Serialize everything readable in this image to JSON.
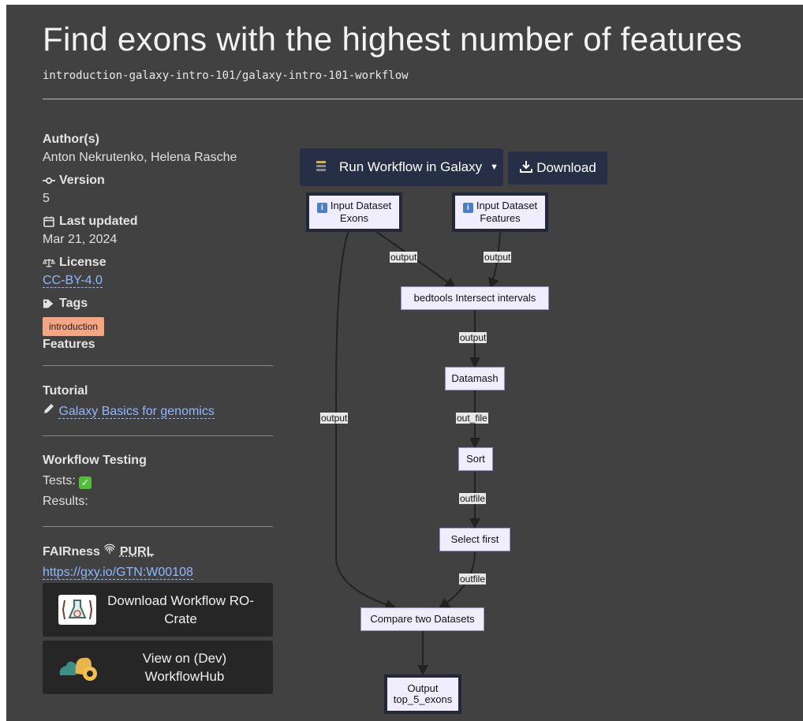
{
  "page": {
    "title": "Find exons with the highest number of features",
    "path": "introduction-galaxy-intro-101/galaxy-intro-101-workflow"
  },
  "meta": {
    "authors_label": "Author(s)",
    "authors": "Anton Nekrutenko, Helena Rasche",
    "version_label": "Version",
    "version": "5",
    "updated_label": "Last updated",
    "updated": "Mar 21, 2024",
    "license_label": "License",
    "license": "CC-BY-4.0",
    "tags_label": "Tags",
    "tags": [
      "introduction"
    ],
    "features_label": "Features"
  },
  "tutorial": {
    "label": "Tutorial",
    "link": "Galaxy Basics for genomics"
  },
  "testing": {
    "label": "Workflow Testing",
    "tests": "Tests:",
    "results": "Results:"
  },
  "fairness": {
    "label": "FAIRness",
    "purl": "PURL",
    "url": "https://gxy.io/GTN:W00108"
  },
  "buttons": {
    "rocrate": "Download Workflow RO-Crate",
    "workflowhub": "View on (Dev) WorkflowHub",
    "run": "Run Workflow in Galaxy",
    "download": "Download"
  },
  "workflow": {
    "nodes": {
      "input_exons": [
        "Input Dataset",
        "Exons"
      ],
      "input_features": [
        "Input Dataset",
        "Features"
      ],
      "intersect": "bedtools Intersect intervals",
      "datamash": "Datamash",
      "sort": "Sort",
      "select": "Select first",
      "compare": "Compare two Datasets",
      "output": [
        "Output",
        "top_5_exons"
      ]
    },
    "edges": {
      "exons_to_intersect": "output",
      "features_to_intersect": "output",
      "exons_to_compare": "output",
      "intersect_to_datamash": "output",
      "datamash_to_sort": "out_file",
      "sort_to_select": "outfile",
      "select_to_compare": "outfile"
    }
  },
  "colors": {
    "background": "#414141",
    "link": "#8fb8ff",
    "button": "#262f45",
    "node_fill": "#f0eefe",
    "tag": "#f4a582"
  }
}
